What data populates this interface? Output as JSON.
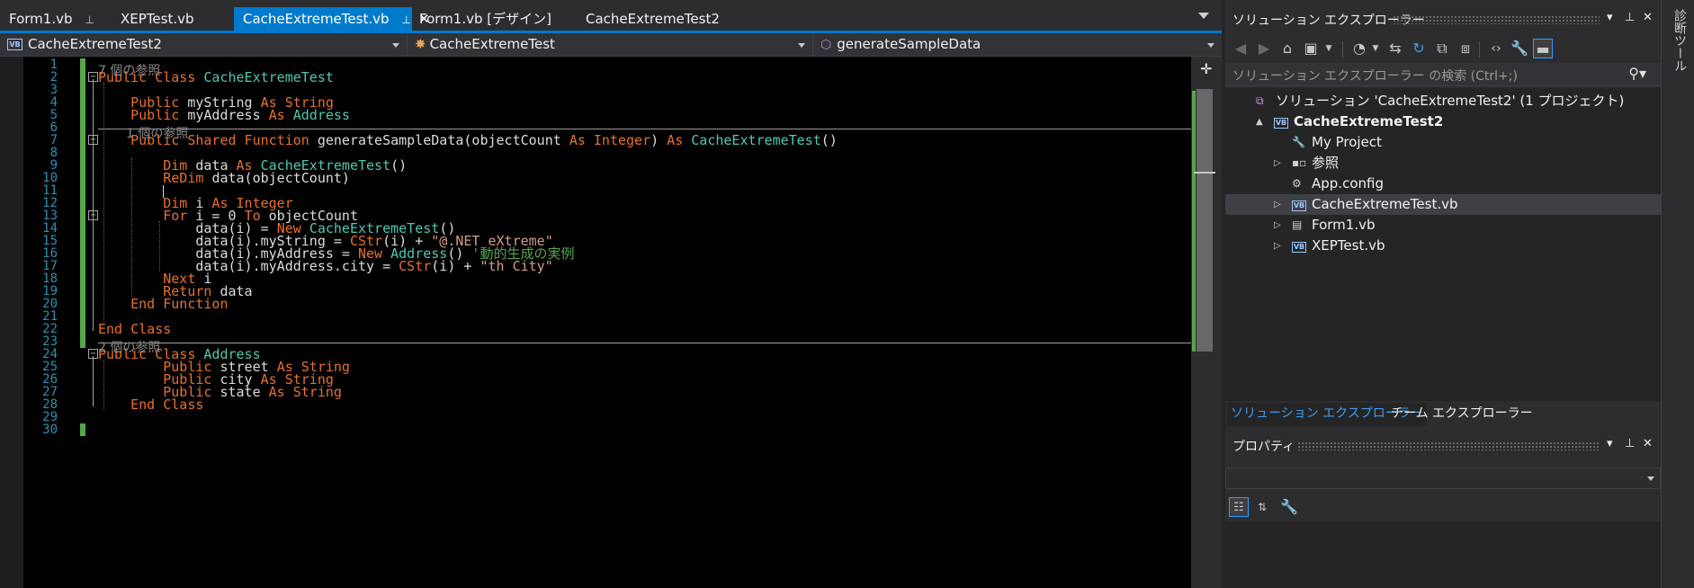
{
  "tabs": [
    {
      "label": "Form1.vb",
      "pinned": true,
      "active": false
    },
    {
      "label": "XEPTest.vb",
      "pinned": false,
      "active": false
    },
    {
      "label": "CacheExtremeTest.vb",
      "pinned": true,
      "active": true
    },
    {
      "label": "Form1.vb [デザイン]",
      "pinned": false,
      "active": false
    },
    {
      "label": "CacheExtremeTest2",
      "pinned": false,
      "active": false
    }
  ],
  "tab_icons": {
    "pin": "pin-icon",
    "close": "close-icon",
    "dropdown": "chevron-down-icon"
  },
  "nav": {
    "project": "CacheExtremeTest2",
    "class": "CacheExtremeTest",
    "member": "generateSampleData",
    "vb_badge": "VB"
  },
  "editor": {
    "line_numbers": [
      "1",
      "2",
      "3",
      "4",
      "5",
      "6",
      "7",
      "8",
      "9",
      "10",
      "11",
      "12",
      "13",
      "14",
      "15",
      "16",
      "17",
      "18",
      "19",
      "20",
      "21",
      "22",
      "23",
      "24",
      "25",
      "26",
      "27",
      "28",
      "29",
      "30"
    ],
    "references": {
      "class1": "7 個の参照",
      "method": "1 個の参照",
      "class2": "2 個の参照"
    },
    "fold_sign": "−",
    "lines": [
      {
        "line": 2,
        "tokens": [
          [
            "k",
            "Public Class "
          ],
          [
            "t",
            "CacheExtremeTest"
          ]
        ]
      },
      {
        "line": 4,
        "tokens": [
          [
            "p",
            "    "
          ],
          [
            "k",
            "Public "
          ],
          [
            "p",
            "myString "
          ],
          [
            "k",
            "As String"
          ]
        ]
      },
      {
        "line": 5,
        "tokens": [
          [
            "p",
            "    "
          ],
          [
            "k",
            "Public "
          ],
          [
            "p",
            "myAddress "
          ],
          [
            "k",
            "As "
          ],
          [
            "t",
            "Address"
          ]
        ]
      },
      {
        "line": 7,
        "tokens": [
          [
            "p",
            "    "
          ],
          [
            "k",
            "Public Shared Function "
          ],
          [
            "p",
            "generateSampleData(objectCount "
          ],
          [
            "k",
            "As Integer"
          ],
          [
            "p",
            ") "
          ],
          [
            "k",
            "As "
          ],
          [
            "t",
            "CacheExtremeTest"
          ],
          [
            "p",
            "()"
          ]
        ]
      },
      {
        "line": 9,
        "tokens": [
          [
            "p",
            "        "
          ],
          [
            "k",
            "Dim "
          ],
          [
            "p",
            "data "
          ],
          [
            "k",
            "As "
          ],
          [
            "t",
            "CacheExtremeTest"
          ],
          [
            "p",
            "()"
          ]
        ]
      },
      {
        "line": 10,
        "tokens": [
          [
            "p",
            "        "
          ],
          [
            "k",
            "ReDim "
          ],
          [
            "p",
            "data(objectCount)"
          ]
        ]
      },
      {
        "line": 11,
        "tokens": [
          [
            "p",
            "        "
          ],
          [
            "caret",
            ""
          ]
        ]
      },
      {
        "line": 12,
        "tokens": [
          [
            "p",
            "        "
          ],
          [
            "k",
            "Dim "
          ],
          [
            "p",
            "i "
          ],
          [
            "k",
            "As Integer"
          ]
        ]
      },
      {
        "line": 13,
        "tokens": [
          [
            "p",
            "        "
          ],
          [
            "k",
            "For "
          ],
          [
            "p",
            "i = 0 "
          ],
          [
            "k",
            "To "
          ],
          [
            "p",
            "objectCount"
          ]
        ]
      },
      {
        "line": 14,
        "tokens": [
          [
            "p",
            "            data(i) = "
          ],
          [
            "k",
            "New "
          ],
          [
            "t",
            "CacheExtremeTest"
          ],
          [
            "p",
            "()"
          ]
        ]
      },
      {
        "line": 15,
        "tokens": [
          [
            "p",
            "            data(i).myString = "
          ],
          [
            "k",
            "CStr"
          ],
          [
            "p",
            "(i) + "
          ],
          [
            "s",
            "\"@.NET eXtreme\""
          ]
        ]
      },
      {
        "line": 16,
        "tokens": [
          [
            "p",
            "            data(i).myAddress = "
          ],
          [
            "k",
            "New "
          ],
          [
            "t",
            "Address"
          ],
          [
            "p",
            "() "
          ],
          [
            "c",
            "'動的生成の実例"
          ]
        ]
      },
      {
        "line": 17,
        "tokens": [
          [
            "p",
            "            data(i).myAddress.city = "
          ],
          [
            "k",
            "CStr"
          ],
          [
            "p",
            "(i) + "
          ],
          [
            "s",
            "\"th City\""
          ]
        ]
      },
      {
        "line": 18,
        "tokens": [
          [
            "p",
            "        "
          ],
          [
            "k",
            "Next "
          ],
          [
            "p",
            "i"
          ]
        ]
      },
      {
        "line": 19,
        "tokens": [
          [
            "p",
            "        "
          ],
          [
            "k",
            "Return "
          ],
          [
            "p",
            "data"
          ]
        ]
      },
      {
        "line": 20,
        "tokens": [
          [
            "p",
            "    "
          ],
          [
            "k",
            "End Function"
          ]
        ]
      },
      {
        "line": 22,
        "tokens": [
          [
            "k",
            "End Class"
          ]
        ]
      },
      {
        "line": 24,
        "tokens": [
          [
            "k",
            "Public Class "
          ],
          [
            "t",
            "Address"
          ]
        ]
      },
      {
        "line": 25,
        "tokens": [
          [
            "p",
            "        "
          ],
          [
            "k",
            "Public "
          ],
          [
            "p",
            "street "
          ],
          [
            "k",
            "As String"
          ]
        ]
      },
      {
        "line": 26,
        "tokens": [
          [
            "p",
            "        "
          ],
          [
            "k",
            "Public "
          ],
          [
            "p",
            "city "
          ],
          [
            "k",
            "As String"
          ]
        ]
      },
      {
        "line": 27,
        "tokens": [
          [
            "p",
            "        "
          ],
          [
            "k",
            "Public "
          ],
          [
            "p",
            "state "
          ],
          [
            "k",
            "As String"
          ]
        ]
      },
      {
        "line": 28,
        "tokens": [
          [
            "p",
            "    "
          ],
          [
            "k",
            "End Class"
          ]
        ]
      }
    ]
  },
  "solution_explorer": {
    "title": "ソリューション エクスプローラー",
    "search_placeholder": "ソリューション エクスプローラー の検索 (Ctrl+;)",
    "tree": [
      {
        "label": "ソリューション 'CacheExtremeTest2' (1 プロジェクト)",
        "icon": "solution-icon",
        "indent": 0,
        "expand": "",
        "bold": false,
        "selected": false
      },
      {
        "label": "CacheExtremeTest2",
        "icon": "vb-project-icon",
        "indent": 1,
        "expand": "▲",
        "bold": true,
        "selected": false
      },
      {
        "label": "My Project",
        "icon": "wrench-icon",
        "indent": 2,
        "expand": "",
        "bold": false,
        "selected": false
      },
      {
        "label": "参照",
        "icon": "references-icon",
        "indent": 2,
        "expand": "▷",
        "bold": false,
        "selected": false
      },
      {
        "label": "App.config",
        "icon": "config-file-icon",
        "indent": 2,
        "expand": "",
        "bold": false,
        "selected": false
      },
      {
        "label": "CacheExtremeTest.vb",
        "icon": "vb-file-icon",
        "indent": 2,
        "expand": "▷",
        "bold": false,
        "selected": true
      },
      {
        "label": "Form1.vb",
        "icon": "form-icon",
        "indent": 2,
        "expand": "▷",
        "bold": false,
        "selected": false
      },
      {
        "label": "XEPTest.vb",
        "icon": "vb-file-icon",
        "indent": 2,
        "expand": "▷",
        "bold": false,
        "selected": false
      }
    ],
    "bottom_tabs": [
      "ソリューション エクスプローラー",
      "チーム エクスプローラー"
    ],
    "toolbar_icons": [
      "back-icon",
      "forward-icon",
      "home-icon",
      "switch-views-icon",
      "history-icon",
      "sync-icon",
      "refresh-icon",
      "collapse-all-icon",
      "show-all-files-icon",
      "view-code-icon",
      "properties-icon",
      "preview-icon"
    ]
  },
  "properties": {
    "title": "プロパティ",
    "toolbar_icons": [
      "categorized-icon",
      "alphabetical-icon",
      "property-pages-icon"
    ]
  },
  "side_tab": {
    "label": "診断ツール"
  },
  "window_controls": {
    "dropdown": "▾",
    "pin": "⊥",
    "close": "✕"
  },
  "colors": {
    "accent": "#007acc",
    "keyword": "#e8702a",
    "type": "#4ec9b0",
    "string": "#d69d85",
    "comment": "#57a64a",
    "line_number": "#2b91af",
    "change_bar": "#57a64a"
  }
}
